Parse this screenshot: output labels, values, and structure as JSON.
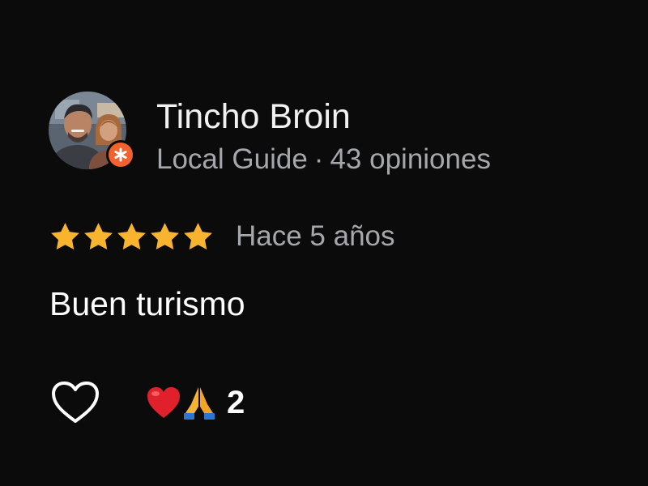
{
  "author": {
    "name": "Tincho Broin",
    "badge": "Local Guide",
    "separator": "·",
    "reviews_count": "43 opiniones",
    "avatar_icon": "user-avatar-photo",
    "badge_icon": "local-guide-star-icon",
    "badge_color": "#f2622e"
  },
  "review": {
    "rating": 5,
    "max_rating": 5,
    "star_color": "#f9b42f",
    "date": "Hace 5 años",
    "text": "Buen turismo"
  },
  "actions": {
    "like_icon": "heart-outline-icon",
    "reactions": [
      "red-heart-emoji",
      "folded-hands-emoji"
    ],
    "reaction_count": "2"
  },
  "colors": {
    "background": "#0b0b0c",
    "primary_text": "#ffffff",
    "secondary_text": "#a6a6ad"
  }
}
